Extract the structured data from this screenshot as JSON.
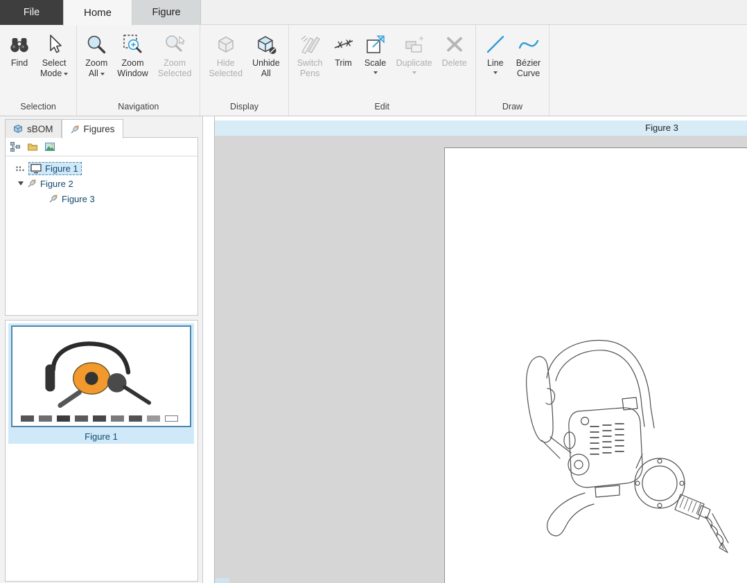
{
  "app_tabs": {
    "file": "File",
    "home": "Home",
    "figure": "Figure"
  },
  "ribbon": {
    "groups": {
      "selection": {
        "label": "Selection"
      },
      "navigation": {
        "label": "Navigation"
      },
      "display": {
        "label": "Display"
      },
      "edit": {
        "label": "Edit"
      },
      "draw": {
        "label": "Draw"
      }
    },
    "buttons": {
      "find": {
        "l1": "Find",
        "l2": "",
        "icon": "binoculars-icon",
        "enabled": true,
        "dropdown": false
      },
      "select_mode": {
        "l1": "Select",
        "l2": "Mode",
        "icon": "cursor-arrow-icon",
        "enabled": true,
        "dropdown": true
      },
      "zoom_all": {
        "l1": "Zoom",
        "l2": "All",
        "icon": "zoom-icon",
        "enabled": true,
        "dropdown": true
      },
      "zoom_window": {
        "l1": "Zoom",
        "l2": "Window",
        "icon": "zoom-window-icon",
        "enabled": true,
        "dropdown": false
      },
      "zoom_selected": {
        "l1": "Zoom",
        "l2": "Selected",
        "icon": "zoom-selected-icon",
        "enabled": false,
        "dropdown": false
      },
      "hide_selected": {
        "l1": "Hide",
        "l2": "Selected",
        "icon": "hide-cube-icon",
        "enabled": false,
        "dropdown": false
      },
      "unhide_all": {
        "l1": "Unhide",
        "l2": "All",
        "icon": "unhide-cube-icon",
        "enabled": true,
        "dropdown": false
      },
      "switch_pens": {
        "l1": "Switch",
        "l2": "Pens",
        "icon": "pens-icon",
        "enabled": false,
        "dropdown": false
      },
      "trim": {
        "l1": "Trim",
        "l2": "",
        "icon": "trim-icon",
        "enabled": true,
        "dropdown": false
      },
      "scale": {
        "l1": "Scale",
        "l2": "",
        "icon": "scale-icon",
        "enabled": true,
        "dropdown": true
      },
      "duplicate": {
        "l1": "Duplicate",
        "l2": "",
        "icon": "duplicate-icon",
        "enabled": false,
        "dropdown": true
      },
      "delete": {
        "l1": "Delete",
        "l2": "",
        "icon": "delete-x-icon",
        "enabled": false,
        "dropdown": false
      },
      "line": {
        "l1": "Line",
        "l2": "",
        "icon": "line-icon",
        "enabled": true,
        "dropdown": true
      },
      "bezier": {
        "l1": "Bézier",
        "l2": "Curve",
        "icon": "bezier-curve-icon",
        "enabled": true,
        "dropdown": false
      }
    }
  },
  "sidebar": {
    "tabs": {
      "sbom": {
        "label": "sBOM",
        "icon": "sbom-cube-icon",
        "active": false
      },
      "figures": {
        "label": "Figures",
        "icon": "figures-pin-icon",
        "active": true
      }
    },
    "minibar_icons": [
      "structure-icon",
      "folder-icon",
      "image-icon"
    ],
    "tree": {
      "figure1": {
        "label": "Figure 1",
        "selected": true,
        "icon": "monitor-icon"
      },
      "figure2": {
        "label": "Figure 2",
        "expanded": true,
        "icon": "figure-item-icon"
      },
      "figure3": {
        "label": "Figure 3",
        "child": true,
        "icon": "figure-item-icon"
      }
    },
    "thumbnail": {
      "caption": "Figure 1",
      "selected": true
    }
  },
  "canvas": {
    "window_title": "Figure 3"
  },
  "colors": {
    "accent_blue": "#2e9bd6",
    "selection_fill": "#cfe9f9",
    "selection_border": "#4d86ad",
    "figure_header": "#d8ecf7",
    "canvas_gray": "#d6d6d6",
    "file_tab": "#3e3e3e"
  }
}
